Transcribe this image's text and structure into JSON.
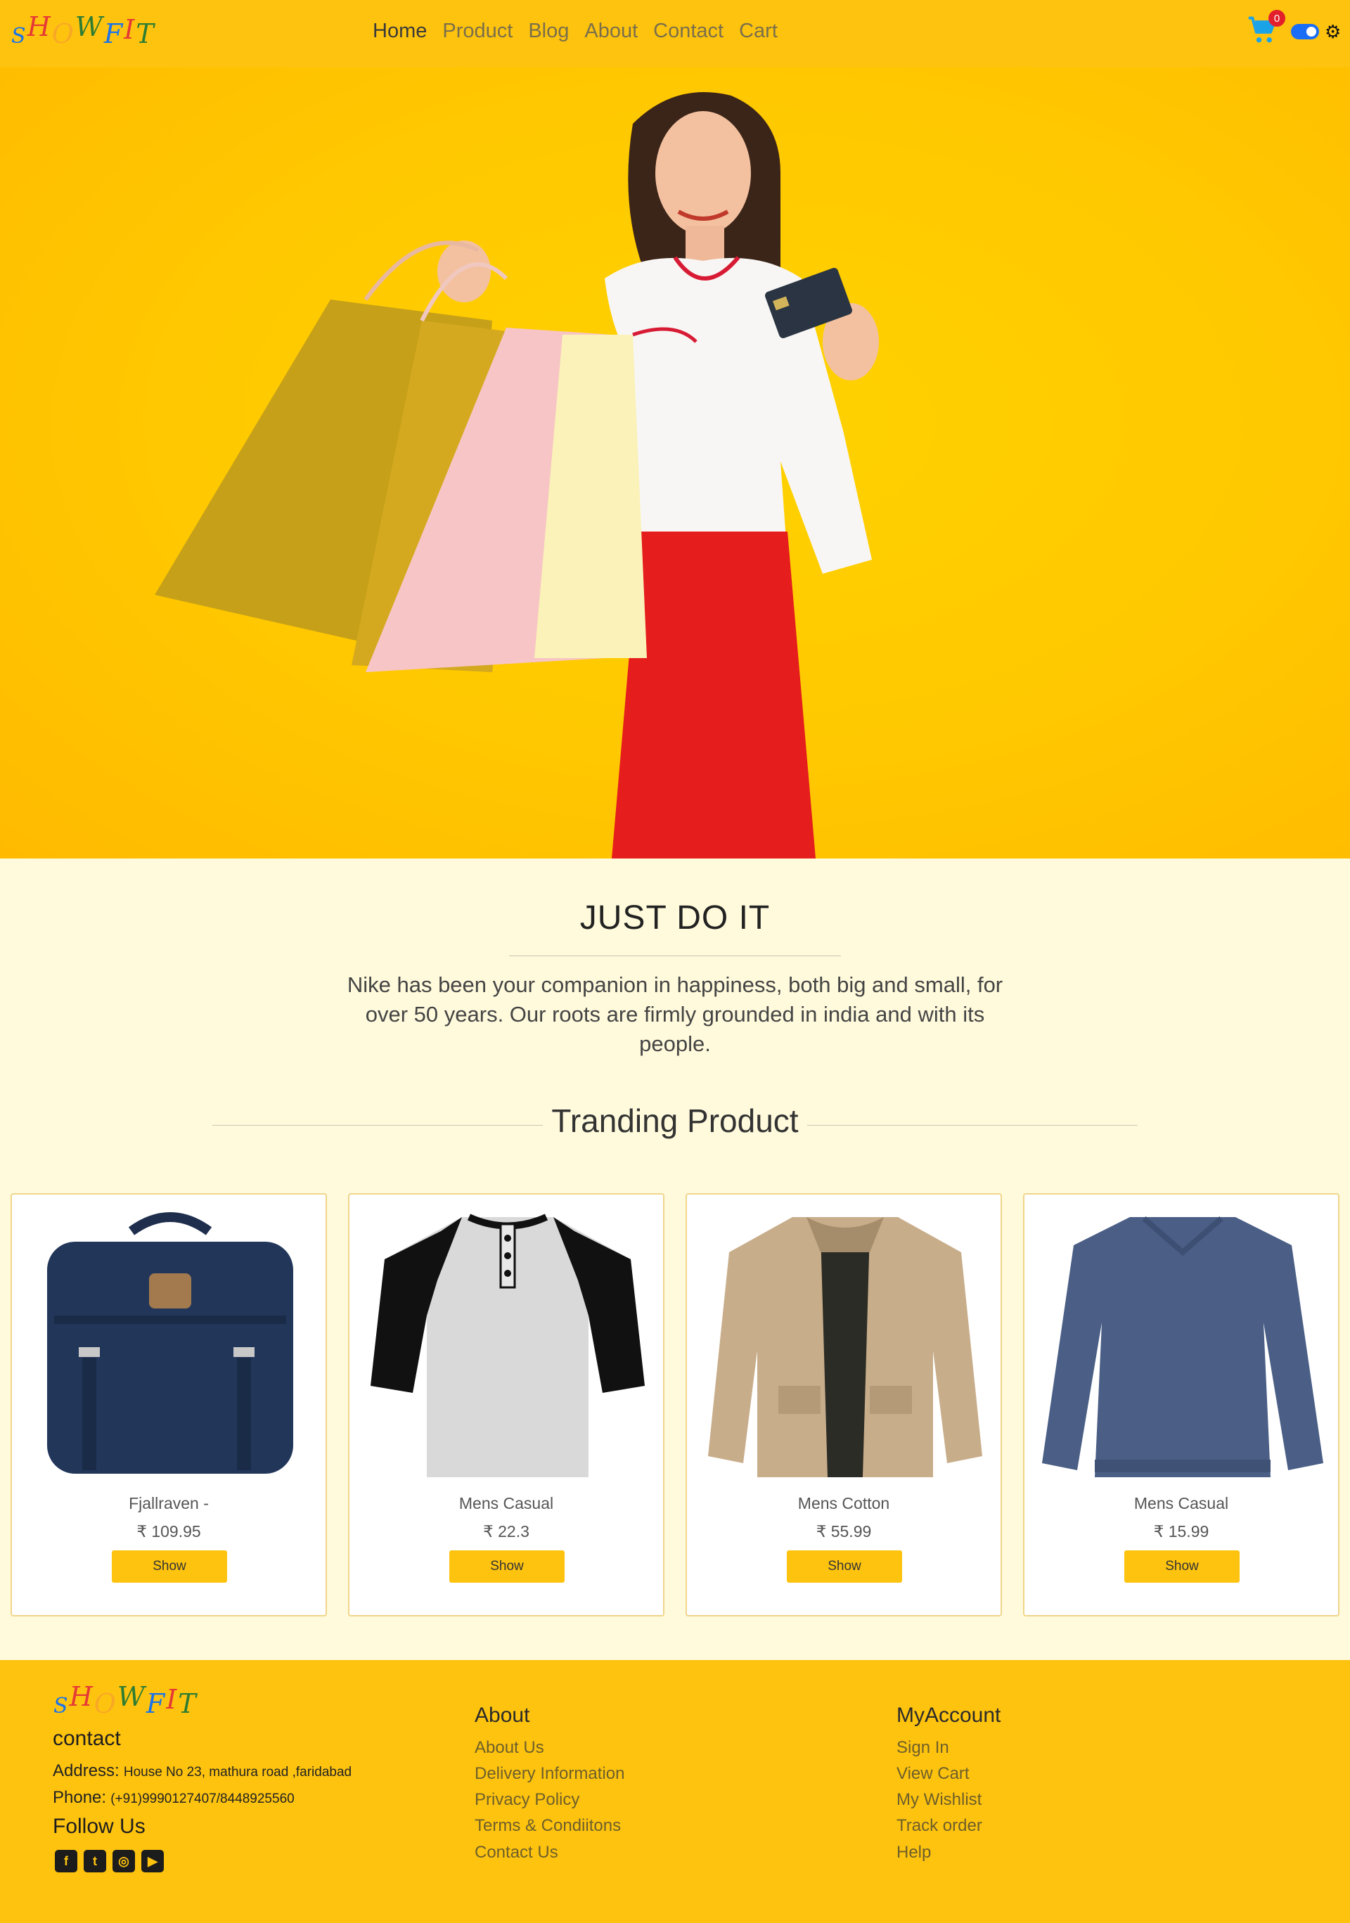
{
  "brand": {
    "logo_letters": [
      "S",
      "H",
      "O",
      "W",
      "F",
      "I",
      "T"
    ],
    "logo_colors": [
      "#1a73e8",
      "#e53935",
      "#f9a825",
      "#2e7d32",
      "#1a73e8",
      "#e53935",
      "#2e7d32"
    ]
  },
  "nav": {
    "items": [
      "Home",
      "Product",
      "Blog",
      "About",
      "Contact",
      "Cart"
    ],
    "cart_count": "0",
    "theme_toggle_icon": "gear-icon"
  },
  "hero": {
    "description": "woman-with-shopping-bags"
  },
  "intro": {
    "title": "JUST DO IT",
    "text": "Nike has been your companion in happiness, both big and small, for over 50 years. Our roots are firmly grounded in india and with its people."
  },
  "trending": {
    "title": "Tranding Product",
    "products": [
      {
        "name": "Fjallraven -",
        "price": "₹ 109.95",
        "button": "Show",
        "image": "backpack"
      },
      {
        "name": "Mens Casual",
        "price": "₹ 22.3",
        "button": "Show",
        "image": "raglan-tee"
      },
      {
        "name": "Mens Cotton",
        "price": "₹ 55.99",
        "button": "Show",
        "image": "jacket"
      },
      {
        "name": "Mens Casual",
        "price": "₹ 15.99",
        "button": "Show",
        "image": "sweater"
      }
    ]
  },
  "footer": {
    "contact_heading": "contact",
    "address_label": "Address:",
    "address_value": "House No 23, mathura road ,faridabad",
    "phone_label": "Phone:",
    "phone_value": "(+91)9990127407/8448925560",
    "follow_heading": "Follow Us",
    "social_icons": [
      "facebook-icon",
      "twitter-icon",
      "instagram-icon",
      "youtube-icon"
    ],
    "about": {
      "heading": "About",
      "links": [
        "About Us",
        "Delivery Information",
        "Privacy Policy",
        "Terms & Condiitons",
        "Contact Us"
      ]
    },
    "account": {
      "heading": "MyAccount",
      "links": [
        "Sign In",
        "View Cart",
        "My Wishlist",
        "Track order",
        "Help"
      ]
    }
  },
  "colors": {
    "primary": "#fec30f",
    "background": "#fffadc",
    "cart_icon": "#1ba3e8",
    "badge": "#e21f2b",
    "toggle": "#1a6ef5"
  }
}
